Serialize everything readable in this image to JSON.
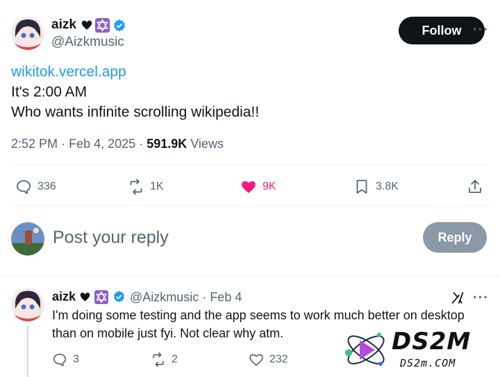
{
  "tweet": {
    "author_name": "aizk",
    "author_handle": "@Aizkmusic",
    "follow_label": "Follow",
    "more_label": "···",
    "link": "wikitok.vercel.app",
    "lines": [
      "It's 2:00 AM",
      "Who wants infinite scrolling wikipedia!!"
    ],
    "time": "2:52 PM",
    "date": "Feb 4, 2025",
    "views_count": "591.9K",
    "views_label": "Views",
    "sep": "·"
  },
  "actions": {
    "replies": "336",
    "reposts": "1K",
    "likes": "9K",
    "bookmarks": "3.8K"
  },
  "compose": {
    "placeholder": "Post your reply",
    "reply_label": "Reply"
  },
  "reply": {
    "author_name": "aizk",
    "author_handle": "@Aizkmusic",
    "date": "Feb 4",
    "sep": "·",
    "lines": [
      "I'm doing some testing and the app seems to work much better on desktop",
      "than on mobile just fyi. Not clear why atm."
    ],
    "replies": "3",
    "reposts": "2",
    "likes": "232",
    "more_label": "···"
  },
  "watermark": {
    "big": "DS2M",
    "small": "DS2m.COM"
  },
  "colors": {
    "accent": "#1d9bf0",
    "like": "#f91880",
    "muted": "#536471"
  }
}
